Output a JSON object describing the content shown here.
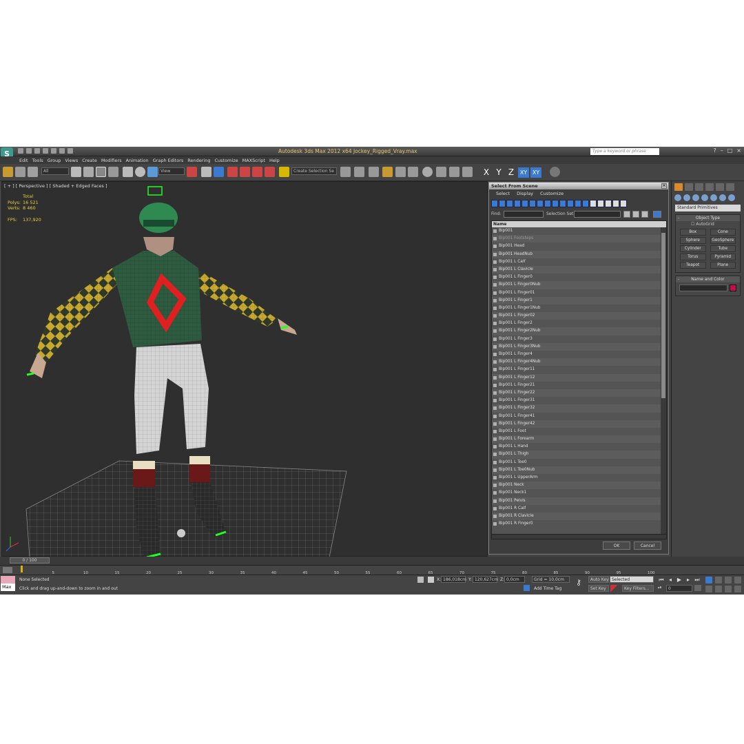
{
  "app": {
    "title": "Autodesk 3ds Max  2012 x64     Jockey_Rigged_Vray.max",
    "logo": "S",
    "search_placeholder": "Type a keyword or phrase"
  },
  "menu": [
    "Edit",
    "Tools",
    "Group",
    "Views",
    "Create",
    "Modifiers",
    "Animation",
    "Graph Editors",
    "Rendering",
    "Customize",
    "MAXScript",
    "Help"
  ],
  "toolbar": {
    "selection_filter": "All",
    "ref_coord": "View",
    "named_selection": "Create Selection Se",
    "axes": [
      "X",
      "Y",
      "Z",
      "XY",
      "XY"
    ]
  },
  "viewport": {
    "label": "[ + ] [ Perspective ] [ Shaded + Edged Faces ]",
    "stats": {
      "total_label": "Total",
      "polys_label": "Polys:",
      "polys": "16 521",
      "verts_label": "Verts:",
      "verts": "8 460",
      "fps_label": "FPS:",
      "fps": "137,920"
    }
  },
  "dialog": {
    "title": "Select From Scene",
    "menus": [
      "Select",
      "Display",
      "Customize"
    ],
    "find_label": "Find:",
    "selection_set_label": "Selection Set:",
    "column_name": "Name",
    "items": [
      "Bip001",
      "Bip001 Footsteps",
      "Bip001 Head",
      "Bip001 HeadNub",
      "Bip001 L Calf",
      "Bip001 L Clavicle",
      "Bip001 L Finger0",
      "Bip001 L Finger0Nub",
      "Bip001 L Finger01",
      "Bip001 L Finger1",
      "Bip001 L Finger1Nub",
      "Bip001 L Finger02",
      "Bip001 L Finger2",
      "Bip001 L Finger2Nub",
      "Bip001 L Finger3",
      "Bip001 L Finger3Nub",
      "Bip001 L Finger4",
      "Bip001 L Finger4Nub",
      "Bip001 L Finger11",
      "Bip001 L Finger12",
      "Bip001 L Finger21",
      "Bip001 L Finger22",
      "Bip001 L Finger31",
      "Bip001 L Finger32",
      "Bip001 L Finger41",
      "Bip001 L Finger42",
      "Bip001 L Foot",
      "Bip001 L Forearm",
      "Bip001 L Hand",
      "Bip001 L Thigh",
      "Bip001 L Toe0",
      "Bip001 L Toe0Nub",
      "Bip001 L UpperArm",
      "Bip001 Neck",
      "Bip001 Neck1",
      "Bip001 Pelvis",
      "Bip001 R Calf",
      "Bip001 R Clavicle",
      "Bip001 R Finger0"
    ],
    "ok": "OK",
    "cancel": "Cancel"
  },
  "command_panel": {
    "category": "Standard Primitives",
    "object_type_title": "Object Type",
    "autogrid": "AutoGrid",
    "primitives": [
      "Box",
      "Cone",
      "Sphere",
      "GeoSphere",
      "Cylinder",
      "Tube",
      "Torus",
      "Pyramid",
      "Teapot",
      "Plane"
    ],
    "name_color_title": "Name and Color",
    "color": "#c0104a"
  },
  "timeline": {
    "frame": "0 / 100",
    "ticks": [
      "5",
      "10",
      "15",
      "20",
      "25",
      "30",
      "35",
      "40",
      "45",
      "50",
      "55",
      "60",
      "65",
      "70",
      "75",
      "80",
      "85",
      "90",
      "95",
      "100"
    ]
  },
  "status": {
    "max_label": "Max",
    "selection": "None Selected",
    "prompt": "Click and drag up-and-down to zoom in and out",
    "x_label": "X:",
    "x": "186,018cm",
    "y_label": "Y:",
    "y": "120,627cm",
    "z_label": "Z:",
    "z": "0,0cm",
    "grid": "Grid = 10,0cm",
    "add_time_tag": "Add Time Tag",
    "auto_key": "Auto Key",
    "set_key": "Set Key",
    "key_mode": "Selected",
    "key_filters": "Key Filters...",
    "frame_value": "0"
  }
}
